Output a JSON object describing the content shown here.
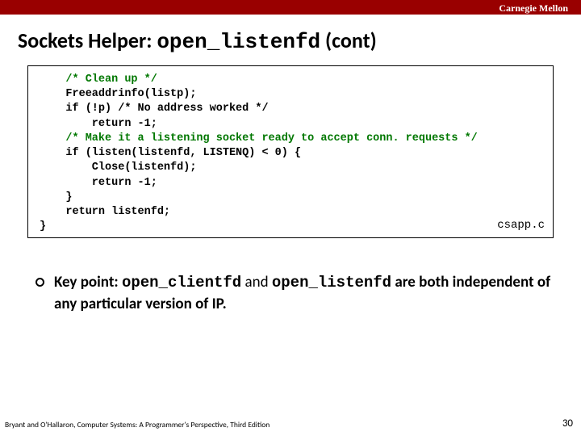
{
  "topbar": {
    "org": "Carnegie Mellon"
  },
  "title": {
    "prefix": "Sockets Helper: ",
    "func": "open_listenfd",
    "suffix": " (cont)"
  },
  "code": {
    "l1": "    /* Clean up */",
    "l2": "    Freeaddrinfo(listp);",
    "l3": "    if (!p) /* No address worked */",
    "l4": "        return -1;",
    "l5": "",
    "l6": "    /* Make it a listening socket ready to accept conn. requests */",
    "l7": "    if (listen(listenfd, LISTENQ) < 0) {",
    "l8": "        Close(listenfd);",
    "l9": "        return -1;",
    "l10": "    }",
    "l11": "    return listenfd;",
    "l12": "}",
    "file": "csapp.c"
  },
  "bullet": {
    "lead": "Key point:",
    "f1": "open_clientfd",
    "mid": " and ",
    "f2": "open_listenfd",
    "trail": " are both independent of any particular version of IP."
  },
  "footer": {
    "ref": "Bryant and O'Hallaron, Computer Systems: A Programmer's Perspective, Third Edition",
    "page": "30"
  }
}
